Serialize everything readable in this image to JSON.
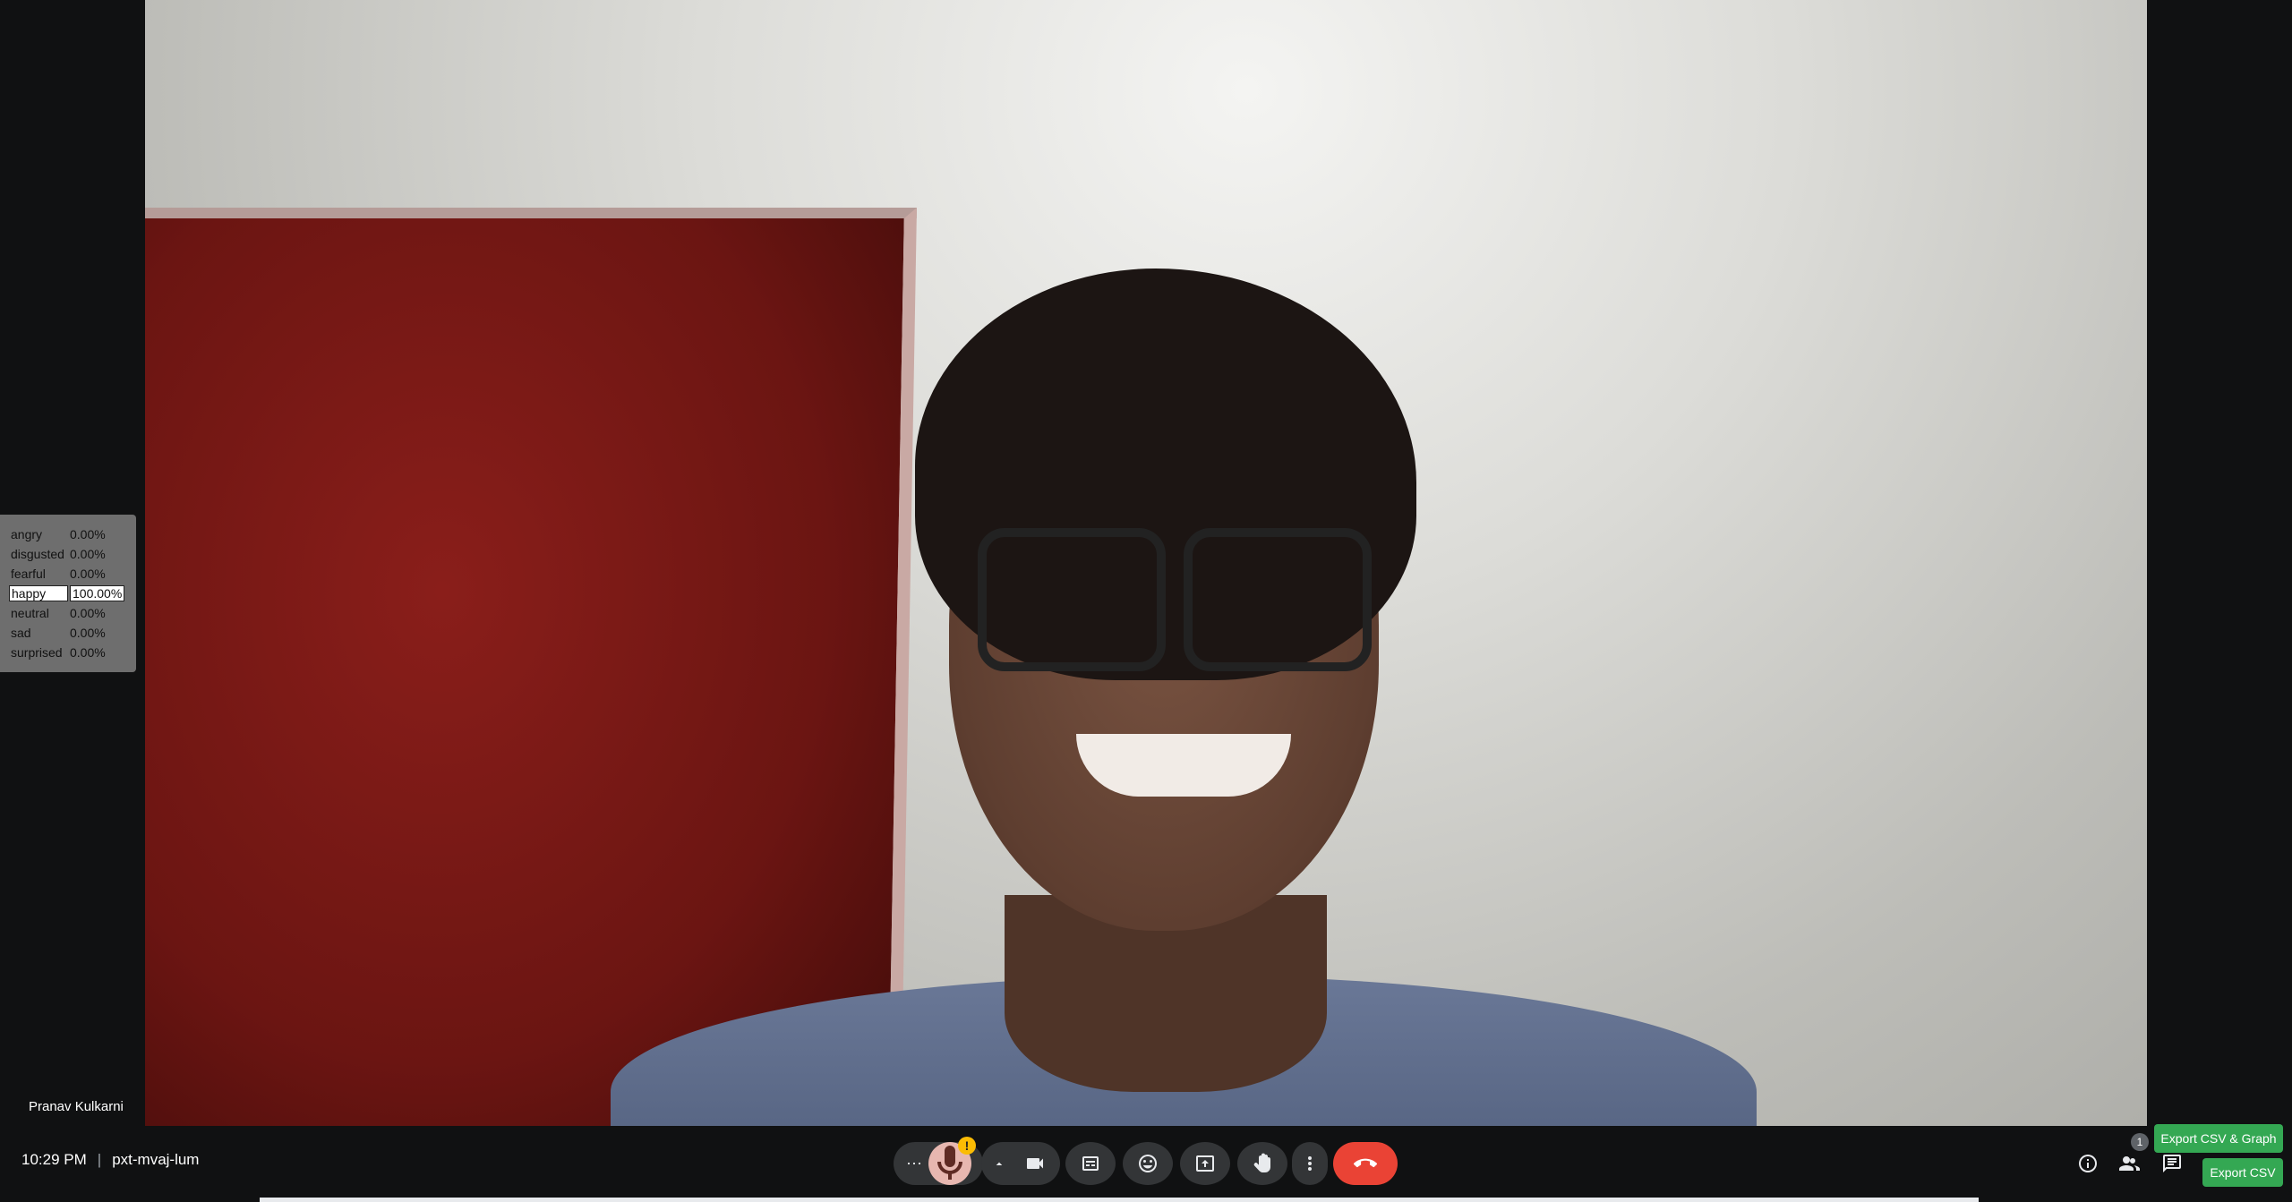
{
  "participant": {
    "name": "Pranav Kulkarni"
  },
  "emotions": [
    {
      "label": "angry",
      "value": "0.00%"
    },
    {
      "label": "disgusted",
      "value": "0.00%"
    },
    {
      "label": "fearful",
      "value": "0.00%"
    },
    {
      "label": "happy",
      "value": "100.00%"
    },
    {
      "label": "neutral",
      "value": "0.00%"
    },
    {
      "label": "sad",
      "value": "0.00%"
    },
    {
      "label": "surprised",
      "value": "0.00%"
    }
  ],
  "meeting": {
    "time": "10:29 PM",
    "separator": "|",
    "code": "pxt-mvaj-lum"
  },
  "controls": {
    "more_options": "⋯",
    "mic_warning": "!",
    "participants_badge": "1"
  },
  "buttons": {
    "export_graph": "Export CSV & Graph",
    "export_csv": "Export CSV"
  },
  "colors": {
    "end_call": "#ea4335",
    "export": "#34a853",
    "warning": "#fbbc04"
  }
}
